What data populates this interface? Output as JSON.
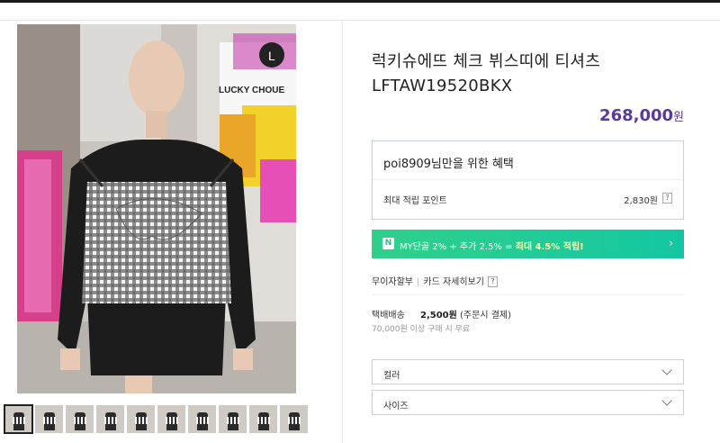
{
  "product": {
    "title_line1": "럭키슈에뜨 체크 뷔스띠에 티셔츠",
    "title_line2": "LFTAW19520BKX",
    "price": "268,000",
    "price_unit": "원"
  },
  "benefit": {
    "header": "poi8909님만을 위한 혜택",
    "points_label": "최대 적립 포인트",
    "points_value": "2,830원",
    "help_glyph": "?"
  },
  "promo": {
    "badge": "N",
    "text": "MY단골 2% + 추가 2.5% = ",
    "highlight": "최대 4.5% 적립!",
    "chevron": "›"
  },
  "payment": {
    "installment_label": "무이자할부",
    "separator": "|",
    "card_details_label": "카드 자세히보기",
    "help_glyph": "?"
  },
  "shipping": {
    "method": "택배배송",
    "fee": "2,500원",
    "fee_note": "(주문시 결제)",
    "free_note": "70,000원 이상 구매 시 무료"
  },
  "options": [
    {
      "label": "컬러"
    },
    {
      "label": "사이즈"
    }
  ],
  "photo": {
    "store_sign": "LUCKY CHOUE",
    "logo_letter": "L",
    "thumbnail_count": 10
  },
  "colors": {
    "accent_price": "#5b3a99",
    "promo_green": "#2fd18a",
    "border": "#cfcfcf"
  }
}
